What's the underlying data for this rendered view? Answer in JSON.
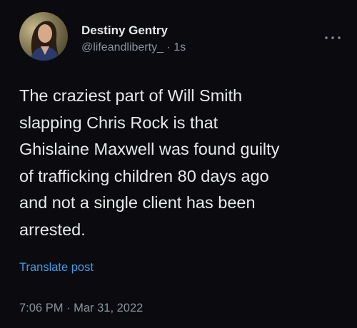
{
  "author": {
    "display_name": "Destiny Gentry",
    "handle": "@lifeandliberty_",
    "separator": "·",
    "relative_time": "1s"
  },
  "tweet": {
    "text": "The craziest part of Will Smith\nslapping Chris Rock is that\nGhislaine Maxwell was found guilty\nof trafficking children 80 days ago\nand not a single client has been\narrested.",
    "translate_label": "Translate post",
    "timestamp": "7:06 PM · Mar 31, 2022"
  },
  "icons": {
    "more": "more-options-icon",
    "avatar": "avatar"
  },
  "colors": {
    "background": "#0b0b0f",
    "text": "#e7e9ea",
    "secondary": "#8b9299",
    "link": "#3e9ee8"
  }
}
